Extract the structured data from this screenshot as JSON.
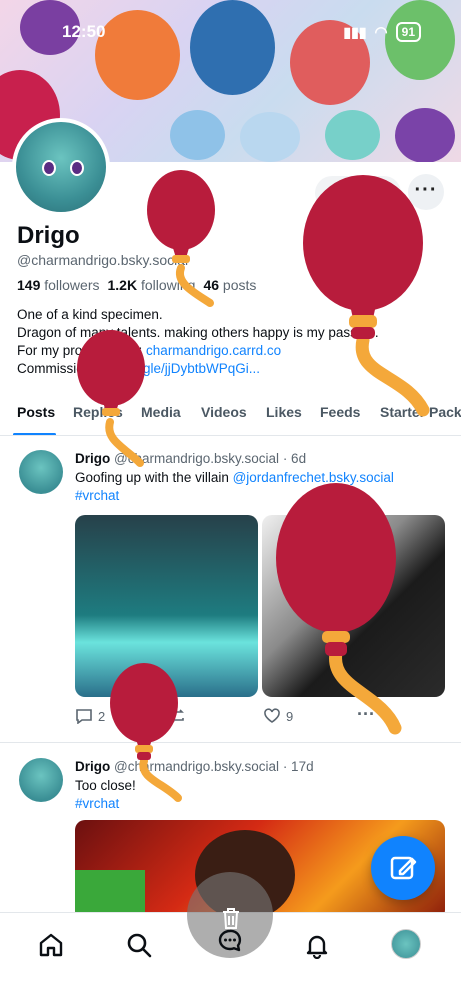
{
  "status_bar": {
    "time": "12:50",
    "battery": "91"
  },
  "profile": {
    "display_name": "Drigo",
    "handle": "@charmandrigo.bsky.social",
    "followers_count": "149",
    "followers_label": "followers",
    "following_count": "1.2K",
    "following_label": "following",
    "posts_count": "46",
    "posts_label": "posts",
    "bio_line1": "One of a kind specimen.",
    "bio_line2": "Dragon of many talents. making others happy is my passion.",
    "bio_line3_prefix": "For my profile check: ",
    "bio_line3_link": "charmandrigo.carrd.co",
    "bio_line4_prefix": "Commissions: ",
    "bio_line4_link": "forms.gle/jjDybtbWPqGi..."
  },
  "tabs": [
    "Posts",
    "Replies",
    "Media",
    "Videos",
    "Likes",
    "Feeds",
    "Starter Packs"
  ],
  "posts": [
    {
      "author": "Drigo",
      "handle": "@charmandrigo.bsky.social",
      "age": "· 6d",
      "text_prefix": "Goofing up with the villain ",
      "mention": "@jordanfrechet.bsky.social",
      "hashtag": "#vrchat",
      "reply_count": "2",
      "like_count": "9"
    },
    {
      "author": "Drigo",
      "handle": "@charmandrigo.bsky.social",
      "age": "· 17d",
      "text": "Too close!",
      "hashtag": "#vrchat"
    }
  ],
  "colors": {
    "accent": "#1083fe",
    "balloon": "#b81c3c",
    "string": "#f4a83a"
  },
  "icons": {
    "home": "home-icon",
    "search": "search-icon",
    "chat": "chat-icon",
    "notifications": "bell-icon",
    "compose": "compose-icon",
    "trash": "trash-icon"
  }
}
